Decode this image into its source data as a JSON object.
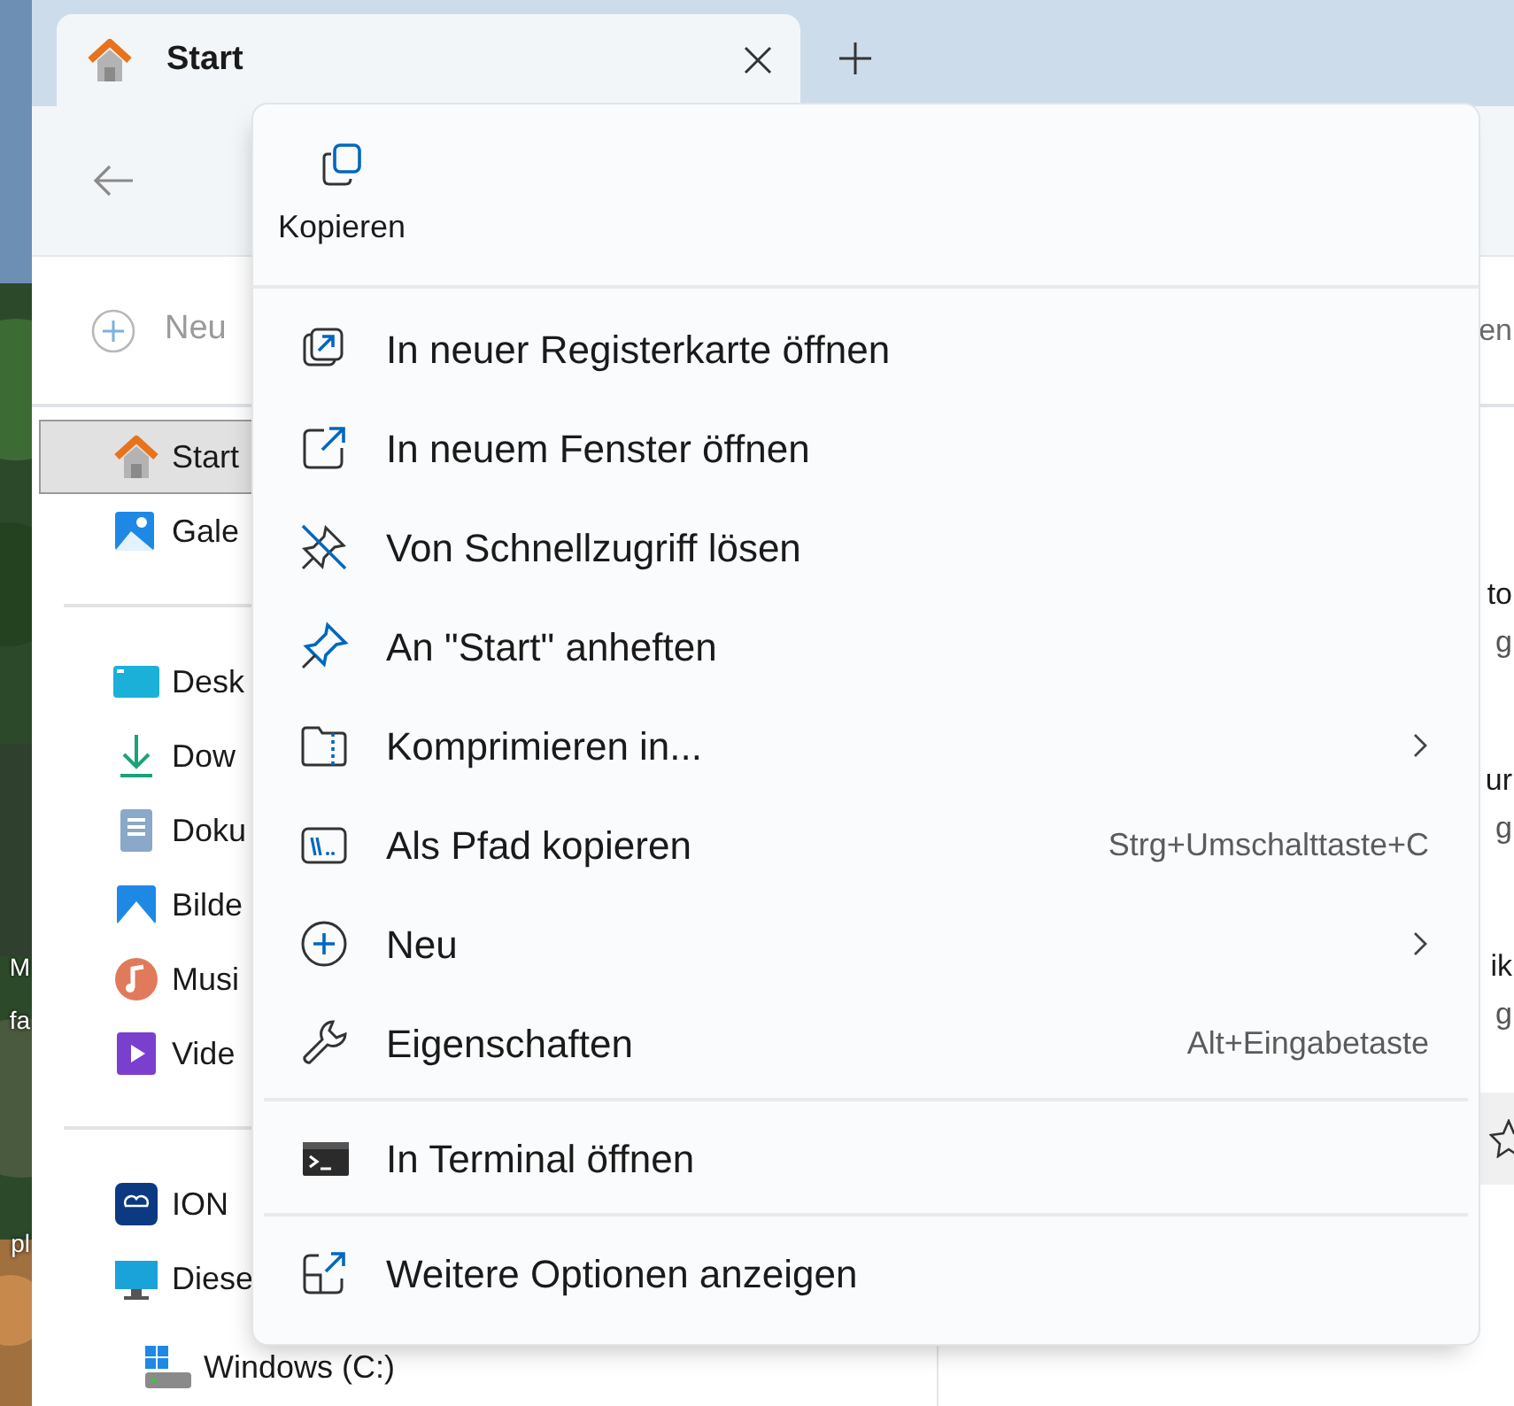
{
  "desktop": {
    "labels": [
      "M",
      "fa",
      "pl"
    ]
  },
  "tabs": [
    {
      "label": "Start",
      "selected": true
    }
  ],
  "command_bar": {
    "new_label": "Neu",
    "disabled": true,
    "edge_text": "en"
  },
  "sidebar": {
    "groups": [
      [
        {
          "label": "Start",
          "selected": true
        },
        {
          "label": "Gale",
          "selected": false
        }
      ],
      [
        {
          "label": "Desk",
          "selected": false
        },
        {
          "label": "Dow",
          "selected": false
        },
        {
          "label": "Doku",
          "selected": false
        },
        {
          "label": "Bilde",
          "selected": false
        },
        {
          "label": "Musi",
          "selected": false
        },
        {
          "label": "Vide",
          "selected": false
        }
      ],
      [
        {
          "label": "ION",
          "selected": false
        },
        {
          "label": "Diese",
          "selected": false,
          "children": [
            {
              "label": "Windows (C:)",
              "selected": false
            }
          ]
        }
      ]
    ]
  },
  "content": {
    "items": [
      {
        "title": "to",
        "subtitle": "g"
      },
      {
        "title": "ur",
        "subtitle": "g"
      },
      {
        "title": "ik",
        "subtitle": "g"
      }
    ]
  },
  "context_menu": {
    "top_actions": [
      {
        "label": "Kopieren"
      }
    ],
    "items": [
      {
        "kind": "item",
        "label": "In neuer Registerkarte öffnen"
      },
      {
        "kind": "item",
        "label": "In neuem Fenster öffnen"
      },
      {
        "kind": "item",
        "label": "Von Schnellzugriff lösen"
      },
      {
        "kind": "item",
        "label": "An \"Start\" anheften"
      },
      {
        "kind": "item",
        "label": "Komprimieren in...",
        "submenu": true
      },
      {
        "kind": "item",
        "label": "Als Pfad kopieren",
        "shortcut": "Strg+Umschalttaste+C"
      },
      {
        "kind": "item",
        "label": "Neu",
        "submenu": true
      },
      {
        "kind": "item",
        "label": "Eigenschaften",
        "shortcut": "Alt+Eingabetaste"
      },
      {
        "kind": "separator"
      },
      {
        "kind": "item",
        "label": "In Terminal öffnen"
      },
      {
        "kind": "separator"
      },
      {
        "kind": "item",
        "label": "Weitere Optionen anzeigen"
      }
    ]
  }
}
